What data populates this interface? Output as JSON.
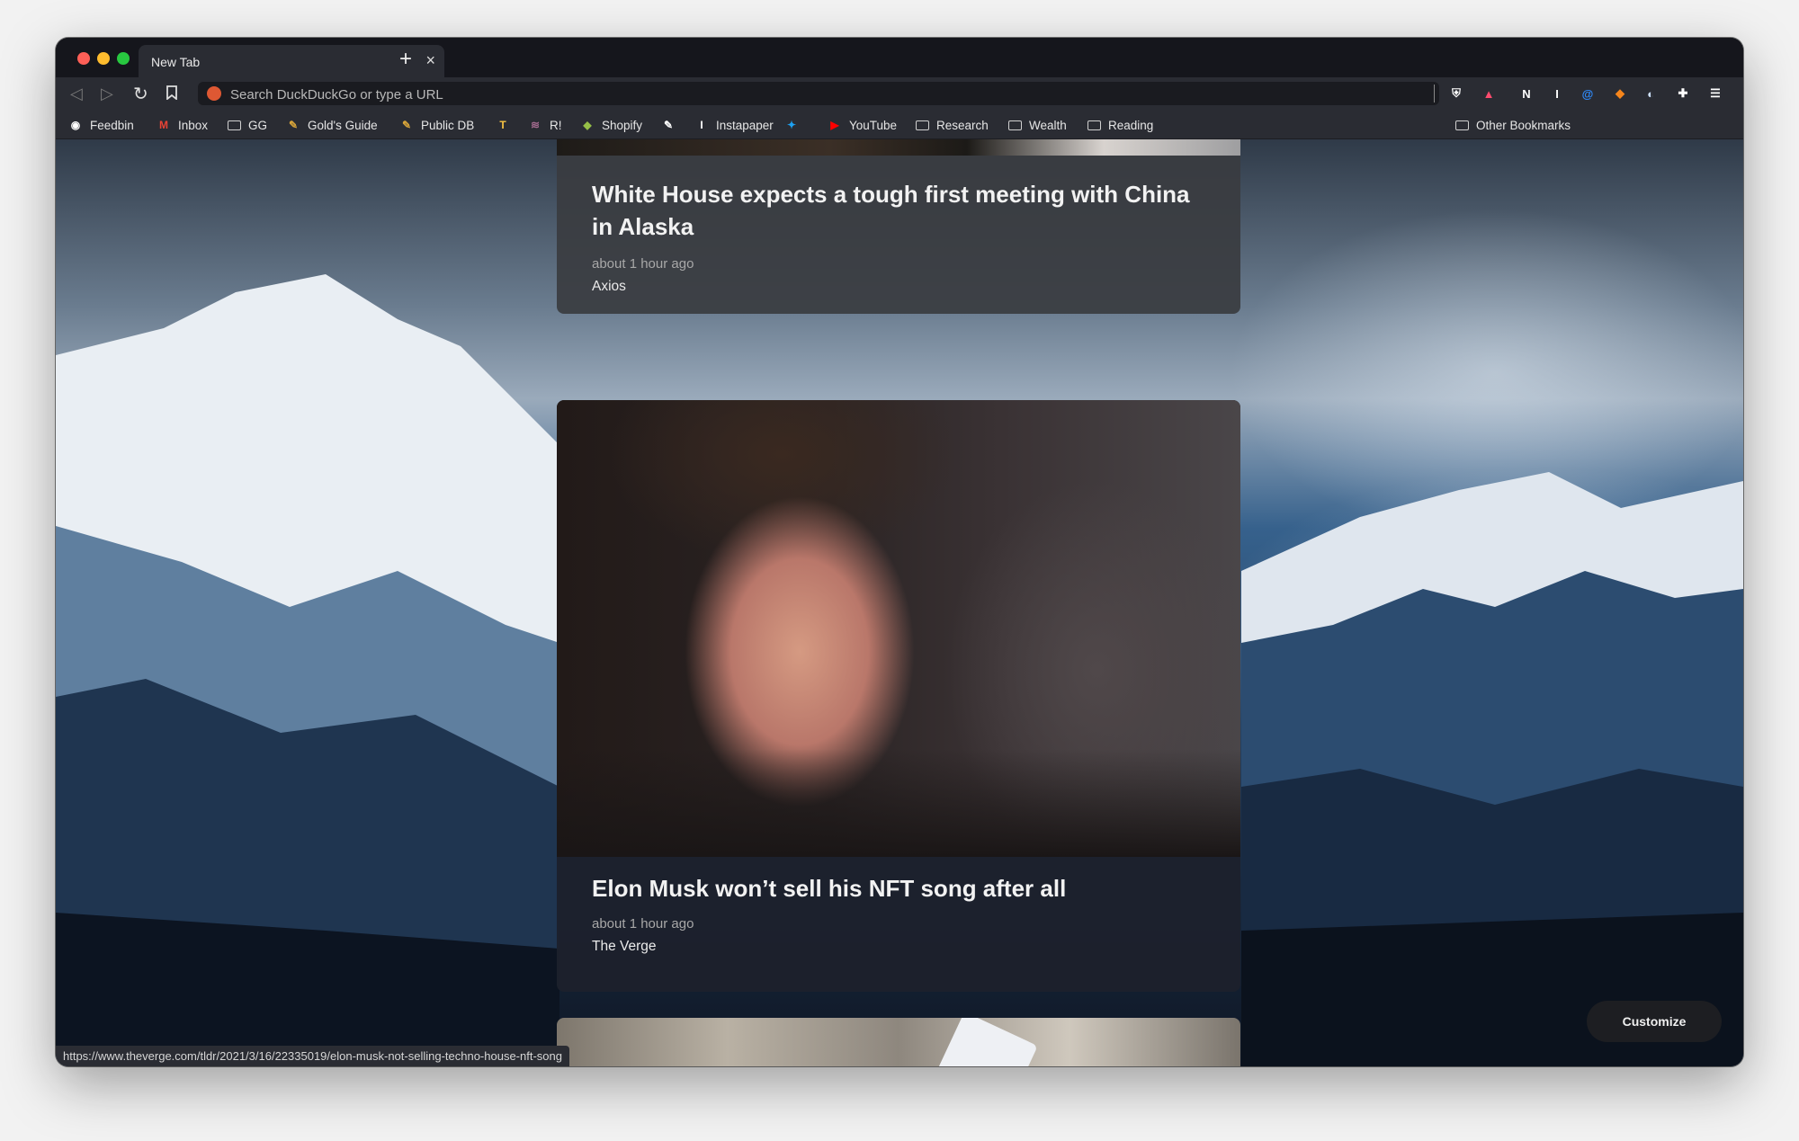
{
  "tab": {
    "title": "New Tab",
    "close": "×",
    "new": "+"
  },
  "toolbar": {
    "back": "◁",
    "forward": "▷",
    "reload": "↻",
    "bookmark": "🔖",
    "url_placeholder": "Search DuckDuckGo or type a URL"
  },
  "extensions": [
    {
      "name": "brave-shield-icon",
      "glyph": "⛨",
      "color": "#ffffff"
    },
    {
      "name": "brave-rewards-icon",
      "glyph": "▲",
      "color": "#ff4b6e"
    },
    {
      "name": "notion-icon",
      "glyph": "N",
      "color": "#ffffff"
    },
    {
      "name": "instapaper-icon",
      "glyph": "I",
      "color": "#ffffff"
    },
    {
      "name": "ethereum-icon",
      "glyph": "@",
      "color": "#2f8cff"
    },
    {
      "name": "metamask-icon",
      "glyph": "◆",
      "color": "#f6851b"
    },
    {
      "name": "globe-icon",
      "glyph": "◐",
      "color": "#cfe3ff"
    },
    {
      "name": "puzzle-icon",
      "glyph": "✚",
      "color": "#ffffff"
    },
    {
      "name": "menu-icon",
      "glyph": "☰",
      "color": "#ffffff"
    }
  ],
  "bookmarks": [
    {
      "label": "Feedbin",
      "icon": "feedbin-icon",
      "glyph": "◉"
    },
    {
      "label": "Inbox",
      "icon": "gmail-icon",
      "glyph": "M"
    },
    {
      "label": "GG",
      "icon": "folder-icon",
      "glyph": ""
    },
    {
      "label": "Gold's Guide",
      "icon": "pencil-icon",
      "glyph": "✎"
    },
    {
      "label": "Public DB",
      "icon": "pencil-icon",
      "glyph": "✎"
    },
    {
      "label": "",
      "icon": "t-logo-icon",
      "glyph": "T"
    },
    {
      "label": "R!",
      "icon": "rank-icon",
      "glyph": "≋"
    },
    {
      "label": "Shopify",
      "icon": "shopify-icon",
      "glyph": "◆"
    },
    {
      "label": "",
      "icon": "robinhood-icon",
      "glyph": "✎"
    },
    {
      "label": "Instapaper",
      "icon": "instapaper-icon",
      "glyph": "I"
    },
    {
      "label": "",
      "icon": "twitter-icon",
      "glyph": "✦"
    },
    {
      "label": "YouTube",
      "icon": "youtube-icon",
      "glyph": "▶"
    },
    {
      "label": "Research",
      "icon": "folder-icon",
      "glyph": ""
    },
    {
      "label": "Wealth",
      "icon": "folder-icon",
      "glyph": ""
    },
    {
      "label": "Reading",
      "icon": "folder-icon",
      "glyph": ""
    }
  ],
  "other_bookmarks": "Other Bookmarks",
  "cards": [
    {
      "title": "White House expects a tough first meeting with China in Alaska",
      "time": "about 1 hour ago",
      "source": "Axios"
    },
    {
      "title": "Elon Musk won’t sell his NFT song after all",
      "time": "about 1 hour ago",
      "source": "The Verge"
    }
  ],
  "customize_label": "Customize",
  "status_url": "https://www.theverge.com/tldr/2021/3/16/22335019/elon-musk-not-selling-techno-house-nft-song"
}
